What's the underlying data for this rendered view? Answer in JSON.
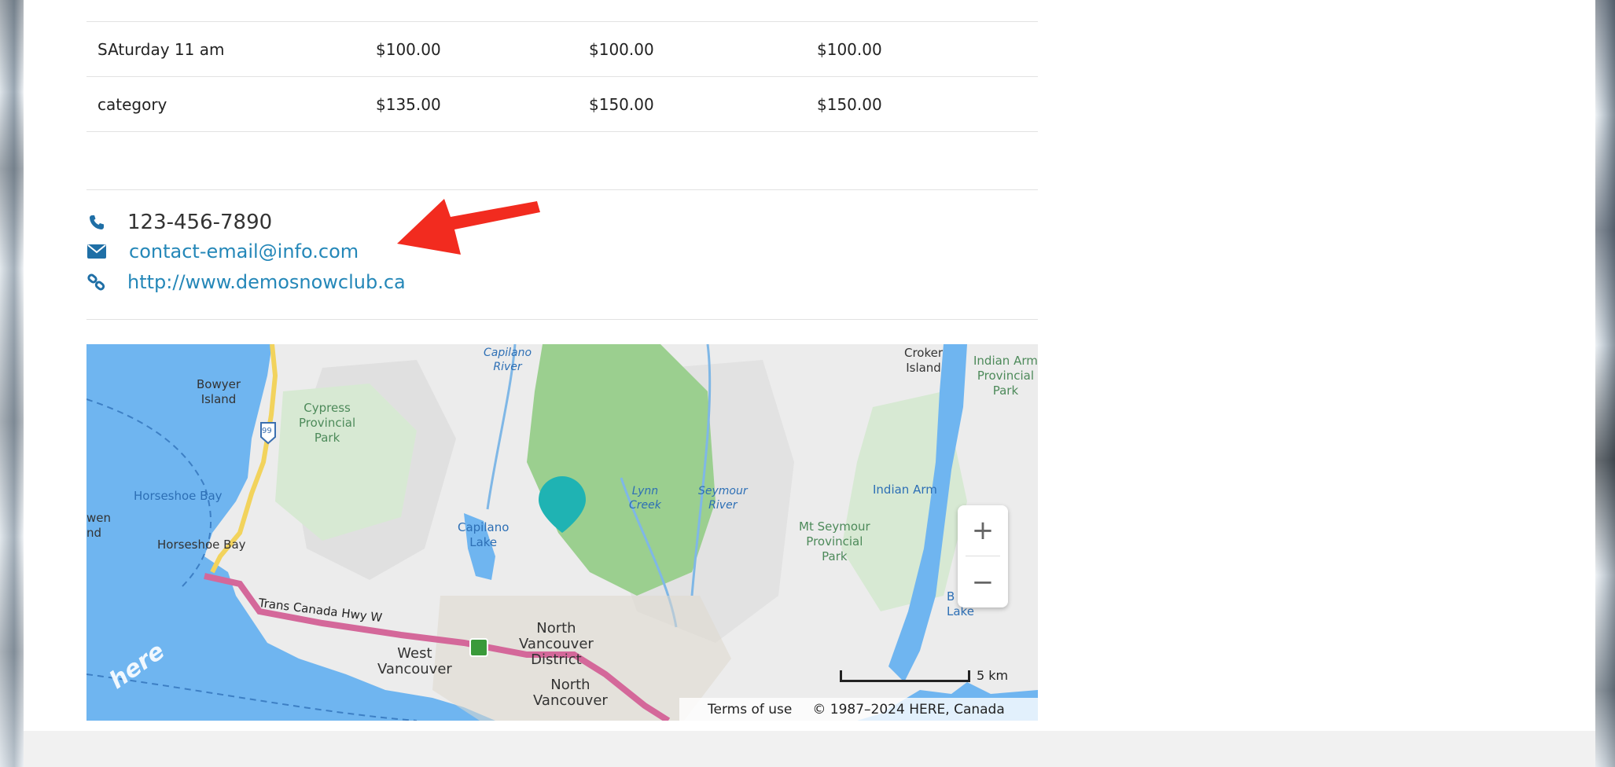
{
  "rates_table": {
    "rows": [
      {
        "label": "",
        "c1": "",
        "c2": "",
        "c3": ""
      },
      {
        "label": "SAturday 11 am",
        "c1": "$100.00",
        "c2": "$100.00",
        "c3": "$100.00"
      },
      {
        "label": "category",
        "c1": "$135.00",
        "c2": "$150.00",
        "c3": "$150.00"
      }
    ]
  },
  "contact": {
    "phone": "123-456-7890",
    "email": "contact-email@info.com",
    "website": "http://www.demosnowclub.ca"
  },
  "map": {
    "labels": {
      "capilano_river": "Capilano\nRiver",
      "bowyer_island": "Bowyer\nIsland",
      "cypress_park": "Cypress\nProvincial\nPark",
      "croker_island": "Croker\nIsland",
      "indian_arm_park": "Indian Arm\nProvincial\nPark",
      "horseshoe_bay_water": "Horseshoe Bay",
      "horseshoe_bay_town": "Horseshoe Bay",
      "capilano_lake": "Capilano\nLake",
      "lynn_creek": "Lynn\nCreek",
      "seymour_river": "Seymour\nRiver",
      "indian_arm": "Indian Arm",
      "mt_seymour_park": "Mt Seymour\nProvincial\nPark",
      "trans_canada": "Trans Canada Hwy W",
      "north_van_district": "North\nVancouver\nDistrict",
      "north_van": "North\nVancouver",
      "west_van": "West\nVancouver",
      "lake_partial": "B\nLake",
      "island_partial": "wen\nnd",
      "highway_shield": "99"
    },
    "zoom_in": "+",
    "zoom_out": "−",
    "scale": "5 km",
    "terms": "Terms of use",
    "copyright": "© 1987–2024 HERE, Canada",
    "logo": "here",
    "colors": {
      "water": "#6fb5f0",
      "park": "#9bcf8f",
      "marker": "#1fb3b3",
      "highway": "#d4689a"
    }
  }
}
